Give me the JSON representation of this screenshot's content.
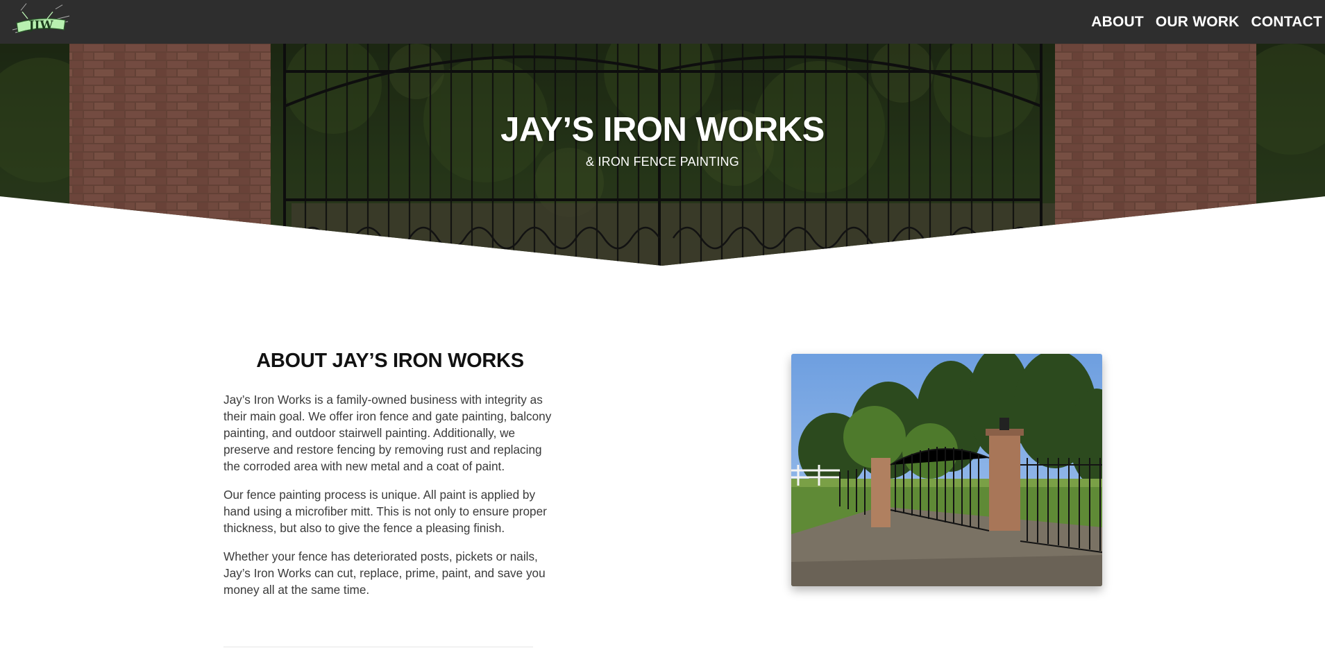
{
  "nav": {
    "logo_icon": "jiw-logo-icon",
    "links": [
      "ABOUT",
      "OUR WORK",
      "CONTACT"
    ]
  },
  "hero": {
    "title": "JAY’S IRON WORKS",
    "subtitle": "& IRON FENCE PAINTING",
    "background": "iron-gate-photo"
  },
  "about": {
    "heading": "ABOUT JAY’S IRON WORKS",
    "paragraphs": [
      "Jay’s Iron Works is a family-owned business with integrity as their main goal. We offer iron fence and gate painting, balcony painting, and outdoor stairwell painting. Additionally, we preserve and restore fencing by removing rust and replacing the corroded area with new metal and a coat of paint.",
      "Our fence painting process is unique. All paint is applied by hand using a microfiber mitt. This is not only to ensure proper thickness, but also to give the fence a pleasing finish.",
      "Whether your fence has deteriorated posts, pickets or nails, Jay’s Iron Works can cut, replace, prime, paint, and save you money all at the same time."
    ],
    "photo": "gate-driveway-photo"
  },
  "colors": {
    "navbar": "#2e2e2e",
    "text": "#3a3a3a",
    "heading": "#111111",
    "logo_accent": "#b8f0b0"
  }
}
